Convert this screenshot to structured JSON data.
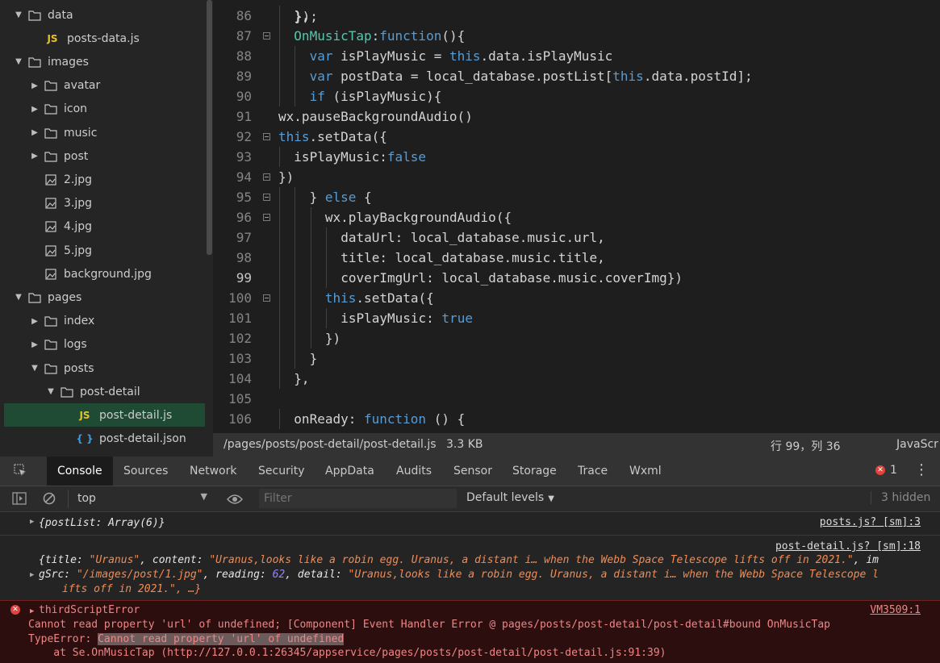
{
  "file_tree": [
    {
      "depth": 0,
      "kind": "folder",
      "open": true,
      "label": "data"
    },
    {
      "depth": 1,
      "kind": "js",
      "label": "posts-data.js"
    },
    {
      "depth": 0,
      "kind": "folder",
      "open": true,
      "label": "images"
    },
    {
      "depth": 1,
      "kind": "folder",
      "open": false,
      "label": "avatar"
    },
    {
      "depth": 1,
      "kind": "folder",
      "open": false,
      "label": "icon"
    },
    {
      "depth": 1,
      "kind": "folder",
      "open": false,
      "label": "music"
    },
    {
      "depth": 1,
      "kind": "folder",
      "open": false,
      "label": "post"
    },
    {
      "depth": 1,
      "kind": "image",
      "label": "2.jpg"
    },
    {
      "depth": 1,
      "kind": "image",
      "label": "3.jpg"
    },
    {
      "depth": 1,
      "kind": "image",
      "label": "4.jpg"
    },
    {
      "depth": 1,
      "kind": "image",
      "label": "5.jpg"
    },
    {
      "depth": 1,
      "kind": "image",
      "label": "background.jpg"
    },
    {
      "depth": 0,
      "kind": "folder",
      "open": true,
      "label": "pages"
    },
    {
      "depth": 1,
      "kind": "folder",
      "open": false,
      "label": "index"
    },
    {
      "depth": 1,
      "kind": "folder",
      "open": false,
      "label": "logs"
    },
    {
      "depth": 1,
      "kind": "folder",
      "open": true,
      "label": "posts"
    },
    {
      "depth": 2,
      "kind": "folder",
      "open": true,
      "label": "post-detail"
    },
    {
      "depth": 3,
      "kind": "js",
      "label": "post-detail.js",
      "selected": true
    },
    {
      "depth": 3,
      "kind": "json",
      "label": "post-detail.json"
    }
  ],
  "code_lines": [
    {
      "n": "86",
      "fold": false,
      "indent": 1,
      "parts": [
        [
          "p",
          "},"
        ]
      ]
    },
    {
      "n": "87",
      "fold": true,
      "indent": 1,
      "parts": [
        [
          "f",
          "OnMusicTap"
        ],
        [
          "p",
          ":"
        ],
        [
          "k",
          "function"
        ],
        [
          "p",
          "(){"
        ]
      ]
    },
    {
      "n": "88",
      "fold": false,
      "indent": 2,
      "parts": [
        [
          "k",
          "var"
        ],
        [
          "p",
          " isPlayMusic = "
        ],
        [
          "k",
          "this"
        ],
        [
          "p",
          ".data.isPlayMusic"
        ]
      ]
    },
    {
      "n": "89",
      "fold": false,
      "indent": 2,
      "parts": [
        [
          "k",
          "var"
        ],
        [
          "p",
          " postData = local_database.postList["
        ],
        [
          "k",
          "this"
        ],
        [
          "p",
          ".data.postId];"
        ]
      ]
    },
    {
      "n": "90",
      "fold": false,
      "indent": 2,
      "parts": [
        [
          "k",
          "if"
        ],
        [
          "p",
          " (isPlayMusic){"
        ]
      ]
    },
    {
      "n": "91",
      "fold": false,
      "indent": 0,
      "parts": [
        [
          "p",
          "wx.pauseBackgroundAudio()"
        ]
      ]
    },
    {
      "n": "92",
      "fold": true,
      "indent": 0,
      "parts": [
        [
          "k",
          "this"
        ],
        [
          "p",
          ".setData({"
        ]
      ]
    },
    {
      "n": "93",
      "fold": false,
      "indent": 1,
      "parts": [
        [
          "p",
          "isPlayMusic:"
        ],
        [
          "k",
          "false"
        ]
      ]
    },
    {
      "n": "94",
      "fold": true,
      "indent": 0,
      "parts": [
        [
          "p",
          "})"
        ]
      ]
    },
    {
      "n": "95",
      "fold": true,
      "indent": 2,
      "parts": [
        [
          "p",
          "} "
        ],
        [
          "k",
          "else"
        ],
        [
          "p",
          " {"
        ]
      ]
    },
    {
      "n": "96",
      "fold": true,
      "indent": 3,
      "parts": [
        [
          "p",
          "wx.playBackgroundAudio({"
        ]
      ]
    },
    {
      "n": "97",
      "fold": false,
      "indent": 4,
      "parts": [
        [
          "p",
          "dataUrl: local_database.music.url,"
        ]
      ]
    },
    {
      "n": "98",
      "fold": false,
      "indent": 4,
      "parts": [
        [
          "p",
          "title: local_database.music.title,"
        ]
      ]
    },
    {
      "n": "99",
      "fold": false,
      "indent": 4,
      "active": true,
      "parts": [
        [
          "p",
          "coverImgUrl: local_database.music.coverImg})"
        ]
      ]
    },
    {
      "n": "100",
      "fold": true,
      "indent": 3,
      "parts": [
        [
          "k",
          "this"
        ],
        [
          "p",
          ".setData({"
        ]
      ]
    },
    {
      "n": "101",
      "fold": false,
      "indent": 4,
      "parts": [
        [
          "p",
          "isPlayMusic: "
        ],
        [
          "k",
          "true"
        ]
      ]
    },
    {
      "n": "102",
      "fold": false,
      "indent": 3,
      "parts": [
        [
          "p",
          "})"
        ]
      ]
    },
    {
      "n": "103",
      "fold": false,
      "indent": 2,
      "parts": [
        [
          "p",
          "}"
        ]
      ]
    },
    {
      "n": "104",
      "fold": false,
      "indent": 1,
      "parts": [
        [
          "p",
          "},"
        ]
      ]
    },
    {
      "n": "105",
      "fold": false,
      "indent": 0,
      "parts": []
    },
    {
      "n": "106",
      "fold": false,
      "indent": 1,
      "parts": [
        [
          "p",
          "onReady: "
        ],
        [
          "k",
          "function"
        ],
        [
          "p",
          " () {"
        ]
      ]
    }
  ],
  "status_bar": {
    "path": "/pages/posts/post-detail/post-detail.js",
    "size": "3.3 KB",
    "cursor": "行 99，列 36",
    "language": "JavaScr"
  },
  "devtools": {
    "tabs": [
      "Console",
      "Sources",
      "Network",
      "Security",
      "AppData",
      "Audits",
      "Sensor",
      "Storage",
      "Trace",
      "Wxml"
    ],
    "active_tab": "Console",
    "error_count": "1",
    "context": "top",
    "filter_placeholder": "Filter",
    "levels": "Default levels",
    "hidden": "3 hidden"
  },
  "console": {
    "msg1_text": "{postList: Array(6)}",
    "msg1_src": "posts.js? [sm]:3",
    "msg2_src": "post-detail.js? [sm]:18",
    "msg2_line1": "{title: \"Uranus\", content: \"Uranus,looks like a robin egg. Uranus, a distant i… when the Webb Space Telescope lifts off in 2021.\", im",
    "msg2_line2": "gSrc: \"/images/post/1.jpg\", reading: 62, detail: \"Uranus,looks like a robin egg. Uranus, a distant i… when the Webb Space Telescope l",
    "msg2_line3": "ifts off in 2021.\", …}",
    "err_title": "thirdScriptError",
    "err_src": "VM3509:1",
    "err_line1": "Cannot read property 'url' of undefined; [Component] Event Handler Error @ pages/posts/post-detail/post-detail#bound OnMusicTap",
    "err_line2_prefix": "TypeError: ",
    "err_line2_highlight": "Cannot read property 'url' of undefined",
    "err_line3": "    at Se.OnMusicTap (http://127.0.0.1:26345/appservice/pages/posts/post-detail/post-detail.js:91:39)"
  }
}
